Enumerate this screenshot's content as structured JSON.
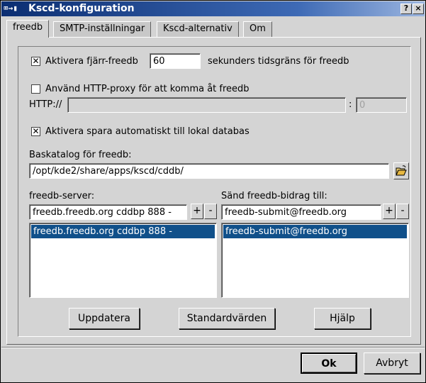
{
  "window": {
    "title": "Kscd-konfiguration",
    "sys_icon": "⌧→▮",
    "help_btn": "?",
    "close_btn": "×"
  },
  "tabs": [
    {
      "label": "freedb",
      "active": true
    },
    {
      "label": "SMTP-inställningar",
      "active": false
    },
    {
      "label": "Kscd-alternativ",
      "active": false
    },
    {
      "label": "Om",
      "active": false
    }
  ],
  "freedb": {
    "remote": {
      "checked": true,
      "check_mark": "✕",
      "label": "Aktivera fjärr-freedb",
      "timeout_value": "60",
      "timeout_suffix": "sekunders tidsgräns för freedb"
    },
    "proxy": {
      "checked": false,
      "label": "Använd HTTP-proxy för att komma åt freedb",
      "http_label": "HTTP://",
      "host_value": "",
      "port_sep": ":",
      "port_value": "0"
    },
    "autosave": {
      "checked": true,
      "check_mark": "✕",
      "label": "Aktivera spara automatiskt till lokal databas"
    },
    "basedir": {
      "label": "Baskatalog för freedb:",
      "value": "/opt/kde2/share/apps/kscd/cddb/"
    },
    "server": {
      "label": "freedb-server:",
      "input_value": "freedb.freedb.org cddbp 888 -",
      "add": "+",
      "remove": "-",
      "items": [
        "freedb.freedb.org cddbp 888 -"
      ]
    },
    "submit": {
      "label": "Sänd freedb-bidrag till:",
      "input_value": "freedb-submit@freedb.org",
      "add": "+",
      "remove": "-",
      "items": [
        "freedb-submit@freedb.org"
      ]
    },
    "buttons": {
      "update": "Uppdatera",
      "defaults": "Standardvärden",
      "help": "Hjälp"
    }
  },
  "footer": {
    "ok": "Ok",
    "cancel": "Avbryt"
  },
  "colors": {
    "titlebar": "#0b2e72",
    "selection": "#10508a",
    "background": "#d4d4d4"
  }
}
